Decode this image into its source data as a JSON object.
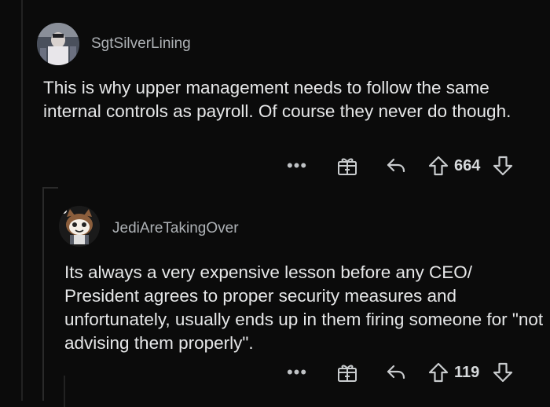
{
  "comments": [
    {
      "username": "SgtSilverLining",
      "text": "This is why upper management needs to follow the same internal controls as payroll. Of course they never do though.",
      "votes": "664",
      "more_label": "•••"
    },
    {
      "username": "JediAreTakingOver",
      "text": "Its always a very expensive lesson before any CEO/ President agrees to proper security measures and unfortunately, usually ends up in them firing someone for \"not advising them properly\".",
      "votes": "119",
      "more_label": "•••"
    }
  ],
  "icons": [
    "more-icon",
    "award-gift-icon",
    "reply-arrow-icon",
    "upvote-arrow-icon",
    "downvote-arrow-icon"
  ],
  "colors": {
    "background": "#0b0b0b",
    "text": "#e6e7e8",
    "muted": "#aeb2b6"
  }
}
